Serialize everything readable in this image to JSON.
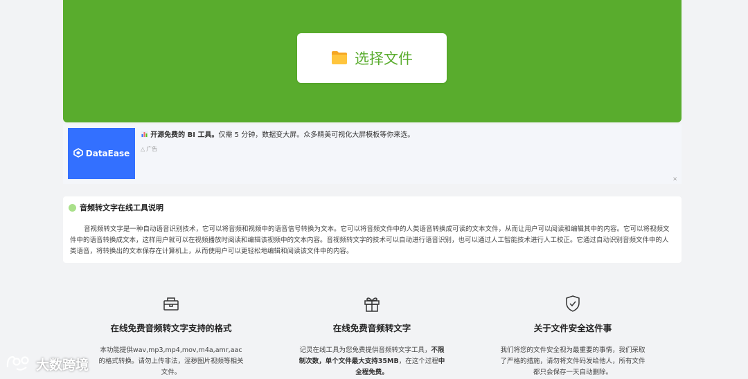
{
  "upload": {
    "button_label": "选择文件"
  },
  "ad": {
    "logo_text": "DataEase",
    "headline_bold": "开源免费的 BI 工具。",
    "headline_rest": "仅需 5 分钟，数据变大屏。众多精美可视化大屏模板等你来选。",
    "tag": "广告",
    "close": "×"
  },
  "description": {
    "title": "音频转文字在线工具说明",
    "body": "音视频转文字是一种自动语音识别技术，它可以将音频和视频中的语音信号转换为文本。它可以将音频文件中的人类语音转换成可读的文本文件，从而让用户可以阅读和编辑其中的内容。它可以将视频文件中的语音转换成文本，这样用户就可以在视频播放时阅读和编辑该视频中的文本内容。音视频转文字的技术可以自动进行语音识别，也可以通过人工智能技术进行人工校正。它通过自动识别音频文件中的人类语音，将转换出的文本保存在计算机上，从而使用户可以更轻松地编辑和阅读该文件中的内容。"
  },
  "features": [
    {
      "icon": "formats-icon",
      "title": "在线免费音频转文字支持的格式",
      "text": "本功能提供wav,mp3,mp4,mov,m4a,amr,aac的格式转换。请勿上传非法，淫秽图片视频等相关文件。"
    },
    {
      "icon": "gift-icon",
      "title": "在线免费音频转文字",
      "text_a": "记灵在线工具为您免费提供音频转文字工具，",
      "text_b": "不限制次数，单个文件最大支持35MB",
      "text_c": "，在这个过程",
      "text_d": "中全程免费。"
    },
    {
      "icon": "shield-check-icon",
      "title": "关于文件安全这件事",
      "text": "我们将您的文件安全视为最重要的事情，我们采取了严格的措施，请勿将文件码发给他人，所有文件都只会保存一天自动删除。"
    }
  ],
  "watermark": {
    "text": "大数跨境"
  },
  "colors": {
    "accent_green": "#59ac2d",
    "ad_blue": "#3370ff"
  }
}
